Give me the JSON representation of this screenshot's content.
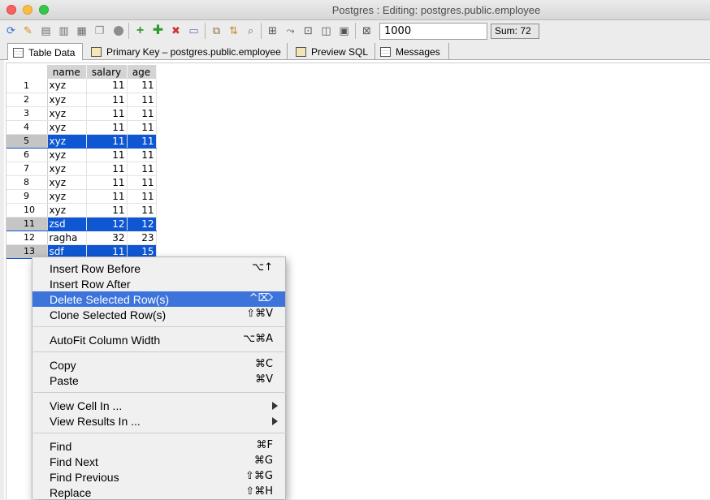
{
  "window": {
    "title": "Postgres : Editing: postgres.public.employee"
  },
  "toolbar": {
    "limit_value": "1000",
    "sum_label": "Sum: 72"
  },
  "tabs": [
    {
      "label": "Table Data",
      "icon": "table-data-icon",
      "active": true
    },
    {
      "label": "Primary Key – postgres.public.employee",
      "icon": "primary-key-icon",
      "active": false
    },
    {
      "label": "Preview SQL",
      "icon": "preview-sql-icon",
      "active": false
    },
    {
      "label": "Messages",
      "icon": "messages-icon",
      "active": false
    }
  ],
  "table": {
    "columns": [
      "name",
      "salary",
      "age"
    ],
    "rows": [
      {
        "n": "1",
        "name": "xyz",
        "salary": "11",
        "age": "11",
        "selected": false
      },
      {
        "n": "2",
        "name": "xyz",
        "salary": "11",
        "age": "11",
        "selected": false
      },
      {
        "n": "3",
        "name": "xyz",
        "salary": "11",
        "age": "11",
        "selected": false
      },
      {
        "n": "4",
        "name": "xyz",
        "salary": "11",
        "age": "11",
        "selected": false
      },
      {
        "n": "5",
        "name": "xyz",
        "salary": "11",
        "age": "11",
        "selected": true
      },
      {
        "n": "6",
        "name": "xyz",
        "salary": "11",
        "age": "11",
        "selected": false
      },
      {
        "n": "7",
        "name": "xyz",
        "salary": "11",
        "age": "11",
        "selected": false
      },
      {
        "n": "8",
        "name": "xyz",
        "salary": "11",
        "age": "11",
        "selected": false
      },
      {
        "n": "9",
        "name": "xyz",
        "salary": "11",
        "age": "11",
        "selected": false
      },
      {
        "n": "10",
        "name": "xyz",
        "salary": "11",
        "age": "11",
        "selected": false
      },
      {
        "n": "11",
        "name": "zsd",
        "salary": "12",
        "age": "12",
        "selected": true
      },
      {
        "n": "12",
        "name": "ragha",
        "salary": "32",
        "age": "23",
        "selected": false
      },
      {
        "n": "13",
        "name": "sdf",
        "salary": "11",
        "age": "15",
        "selected": true
      }
    ]
  },
  "context_menu": {
    "insert_before": {
      "label": "Insert Row Before",
      "shortcut": "⌥↑"
    },
    "insert_after": {
      "label": "Insert Row After",
      "shortcut": ""
    },
    "delete_selected": {
      "label": "Delete Selected Row(s)",
      "shortcut": "^⌦"
    },
    "clone_selected": {
      "label": "Clone Selected Row(s)",
      "shortcut": "⇧⌘V"
    },
    "autofit": {
      "label": "AutoFit Column Width",
      "shortcut": "⌥⌘A"
    },
    "copy": {
      "label": "Copy",
      "shortcut": "⌘C"
    },
    "paste": {
      "label": "Paste",
      "shortcut": "⌘V"
    },
    "view_cell": {
      "label": "View Cell In ..."
    },
    "view_results": {
      "label": "View Results In ..."
    },
    "find": {
      "label": "Find",
      "shortcut": "⌘F"
    },
    "find_next": {
      "label": "Find Next",
      "shortcut": "⌘G"
    },
    "find_previous": {
      "label": "Find Previous",
      "shortcut": "⇧⌘G"
    },
    "replace": {
      "label": "Replace",
      "shortcut": "⇧⌘H"
    }
  },
  "colors": {
    "selection": "#0f57d2",
    "menu_highlight": "#3d74dc"
  }
}
